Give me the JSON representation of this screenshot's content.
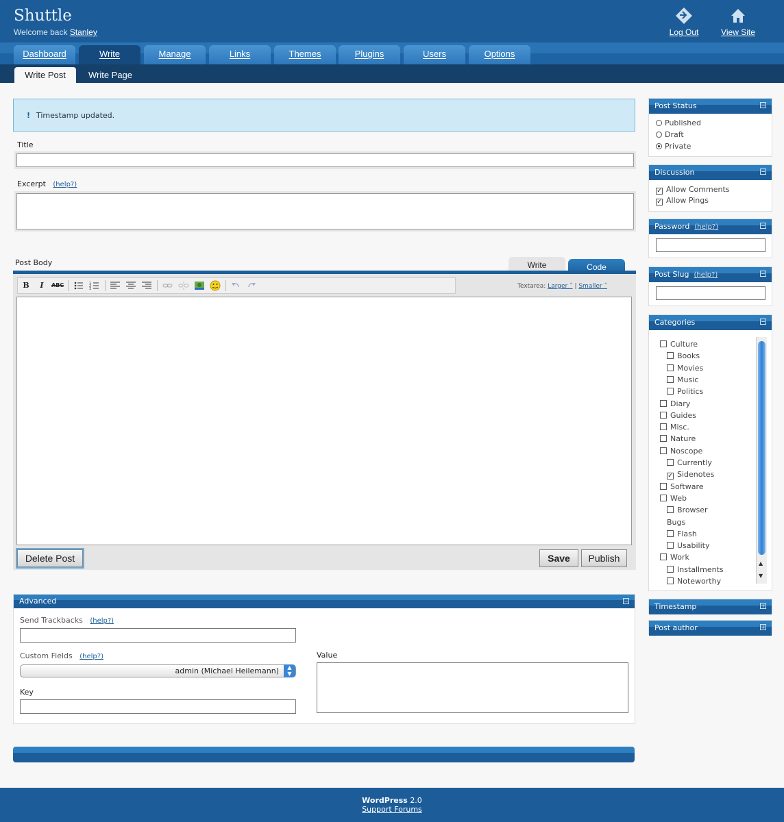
{
  "header": {
    "site_title": "Shuttle",
    "welcome_text": "Welcome back",
    "user_name": "Stanley",
    "logout_label": "Log Out",
    "view_site_label": "View Site"
  },
  "nav": {
    "tabs": [
      {
        "label": "Dashboard",
        "active": false
      },
      {
        "label": "Write",
        "active": true
      },
      {
        "label": "Manage",
        "active": false
      },
      {
        "label": "Links",
        "active": false
      },
      {
        "label": "Themes",
        "active": false
      },
      {
        "label": "Plugins",
        "active": false
      },
      {
        "label": "Users",
        "active": false
      },
      {
        "label": "Options",
        "active": false
      }
    ],
    "subtabs": [
      {
        "label": "Write Post",
        "active": true
      },
      {
        "label": "Write Page",
        "active": false
      }
    ]
  },
  "message": {
    "icon": "!",
    "text": "Timestamp updated."
  },
  "form": {
    "title_label": "Title",
    "title_value": "",
    "excerpt_label": "Excerpt",
    "help_label": "(help?)",
    "excerpt_value": "",
    "post_body_label": "Post Body",
    "tab_write": "Write",
    "tab_code": "Code",
    "textarea_label": "Textarea:",
    "larger_label": "Larger ˆ",
    "smaller_label": "Smaller ˆ",
    "body_value": "",
    "delete_label": "Delete Post",
    "save_label": "Save",
    "publish_label": "Publish"
  },
  "toolbar": {
    "bold": "B",
    "italic": "I",
    "strike": "ABC"
  },
  "advanced": {
    "title": "Advanced",
    "trackbacks_label": "Send Trackbacks",
    "help_label": "(help?)",
    "trackbacks_value": "",
    "custom_fields_label": "Custom Fields",
    "select_value": "admin (Michael Heilemann)",
    "key_label": "Key",
    "value_label": "Value"
  },
  "footer": {
    "product": "WordPress",
    "version": "2.0",
    "support_label": "Support Forums"
  },
  "sidebar": {
    "post_status": {
      "title": "Post Status",
      "options": [
        {
          "label": "Published",
          "checked": false
        },
        {
          "label": "Draft",
          "checked": false
        },
        {
          "label": "Private",
          "checked": true
        }
      ]
    },
    "discussion": {
      "title": "Discussion",
      "options": [
        {
          "label": "Allow Comments",
          "checked": true
        },
        {
          "label": "Allow Pings",
          "checked": true
        }
      ]
    },
    "password": {
      "title": "Password",
      "help": "(help?)",
      "value": ""
    },
    "post_slug": {
      "title": "Post Slug",
      "help": "(help?)",
      "value": ""
    },
    "categories": {
      "title": "Categories",
      "items": [
        {
          "label": "Culture",
          "level": 0,
          "checked": false,
          "checkbox": true
        },
        {
          "label": "Books",
          "level": 1,
          "checked": false,
          "checkbox": true
        },
        {
          "label": "Movies",
          "level": 1,
          "checked": false,
          "checkbox": true
        },
        {
          "label": "Music",
          "level": 1,
          "checked": false,
          "checkbox": true
        },
        {
          "label": "Politics",
          "level": 1,
          "checked": false,
          "checkbox": true
        },
        {
          "label": "Diary",
          "level": 0,
          "checked": false,
          "checkbox": true
        },
        {
          "label": "Guides",
          "level": 0,
          "checked": false,
          "checkbox": true
        },
        {
          "label": "Misc.",
          "level": 0,
          "checked": false,
          "checkbox": true
        },
        {
          "label": "Nature",
          "level": 0,
          "checked": false,
          "checkbox": true
        },
        {
          "label": "Noscope",
          "level": 0,
          "checked": false,
          "checkbox": true
        },
        {
          "label": "Currently",
          "level": 1,
          "checked": false,
          "checkbox": true
        },
        {
          "label": "Sidenotes",
          "level": 1,
          "checked": true,
          "checkbox": true
        },
        {
          "label": "Software",
          "level": 0,
          "checked": false,
          "checkbox": true
        },
        {
          "label": "Web",
          "level": 0,
          "checked": false,
          "checkbox": true
        },
        {
          "label": "Browser",
          "level": 1,
          "checked": false,
          "checkbox": true
        },
        {
          "label": "Bugs",
          "level": 1,
          "checked": false,
          "checkbox": false
        },
        {
          "label": "Flash",
          "level": 1,
          "checked": false,
          "checkbox": true
        },
        {
          "label": "Usability",
          "level": 1,
          "checked": false,
          "checkbox": true
        },
        {
          "label": "Work",
          "level": 0,
          "checked": false,
          "checkbox": true
        },
        {
          "label": "Installments",
          "level": 1,
          "checked": false,
          "checkbox": true
        },
        {
          "label": "Noteworthy",
          "level": 1,
          "checked": false,
          "checkbox": true
        }
      ]
    },
    "timestamp": {
      "title": "Timestamp"
    },
    "post_author": {
      "title": "Post author"
    }
  },
  "colors": {
    "header_blue": "#1c5d99",
    "nav_tab": "#3a86c8",
    "message_bg": "#cfeaf6",
    "subnav": "#15406a"
  }
}
